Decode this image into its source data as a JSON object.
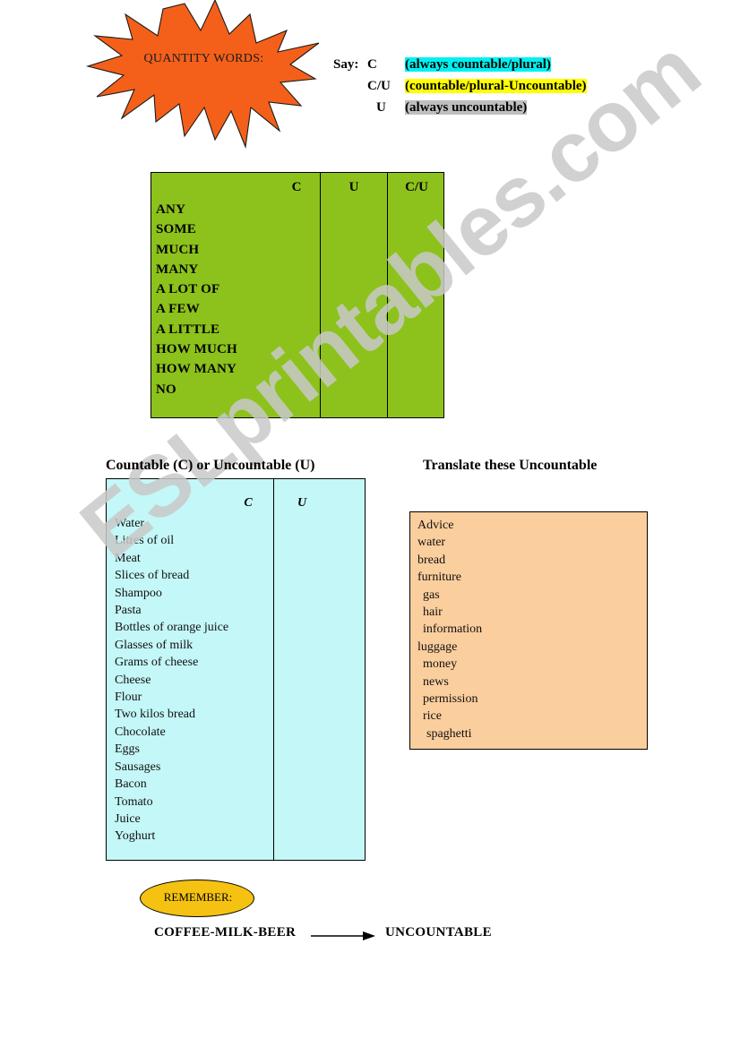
{
  "title_badge": {
    "label": "QUANTITY WORDS:",
    "shape": "starburst",
    "fill_color": "#F4601A"
  },
  "legend": {
    "say_label": "Say:",
    "rows": [
      {
        "code": "C",
        "description": "(always countable/plural)",
        "highlight": "#00F0F0"
      },
      {
        "code": "C/U",
        "description": "(countable/plural-Uncountable)",
        "highlight": "#FFFF00"
      },
      {
        "code": "U",
        "description": "(always uncountable)",
        "highlight": "#BFBFBF"
      }
    ]
  },
  "quantity_table": {
    "fill_color": "#8CC21B",
    "columns": [
      "C",
      "U",
      "C/U"
    ],
    "words": [
      "ANY",
      "SOME",
      "MUCH",
      "MANY",
      "A LOT OF",
      "A FEW",
      "A LITTLE",
      "HOW MUCH",
      "HOW MANY",
      "NO"
    ]
  },
  "countable_section": {
    "heading": "Countable (C) or Uncountable (U)",
    "fill_color": "#C4F7F7",
    "columns": [
      "C",
      "U"
    ],
    "items": [
      "Water",
      "Litres of oil",
      "Meat",
      "Slices of bread",
      "Shampoo",
      "Pasta",
      "Bottles of orange juice",
      "Glasses of milk",
      "Grams of cheese",
      "Cheese",
      "Flour",
      "Two kilos bread",
      "Chocolate",
      "Eggs",
      "Sausages",
      "Bacon",
      "Tomato",
      "Juice",
      "Yoghurt"
    ]
  },
  "translate_section": {
    "heading": "Translate these Uncountable",
    "fill_color": "#FBCE9D",
    "items": [
      "Advice",
      "water",
      "bread",
      "furniture",
      "gas",
      "hair",
      "information",
      "luggage",
      "money",
      "news",
      "permission",
      "rice",
      "spaghetti"
    ]
  },
  "remember_section": {
    "badge_label": "REMEMBER:",
    "badge_color": "#F5C211",
    "left_text": "COFFEE-MILK-BEER",
    "arrow": "arrow-right-icon",
    "right_text": "UNCOUNTABLE"
  },
  "watermark": {
    "text": "ESLprintables.com",
    "color": "#C9C9C9"
  }
}
